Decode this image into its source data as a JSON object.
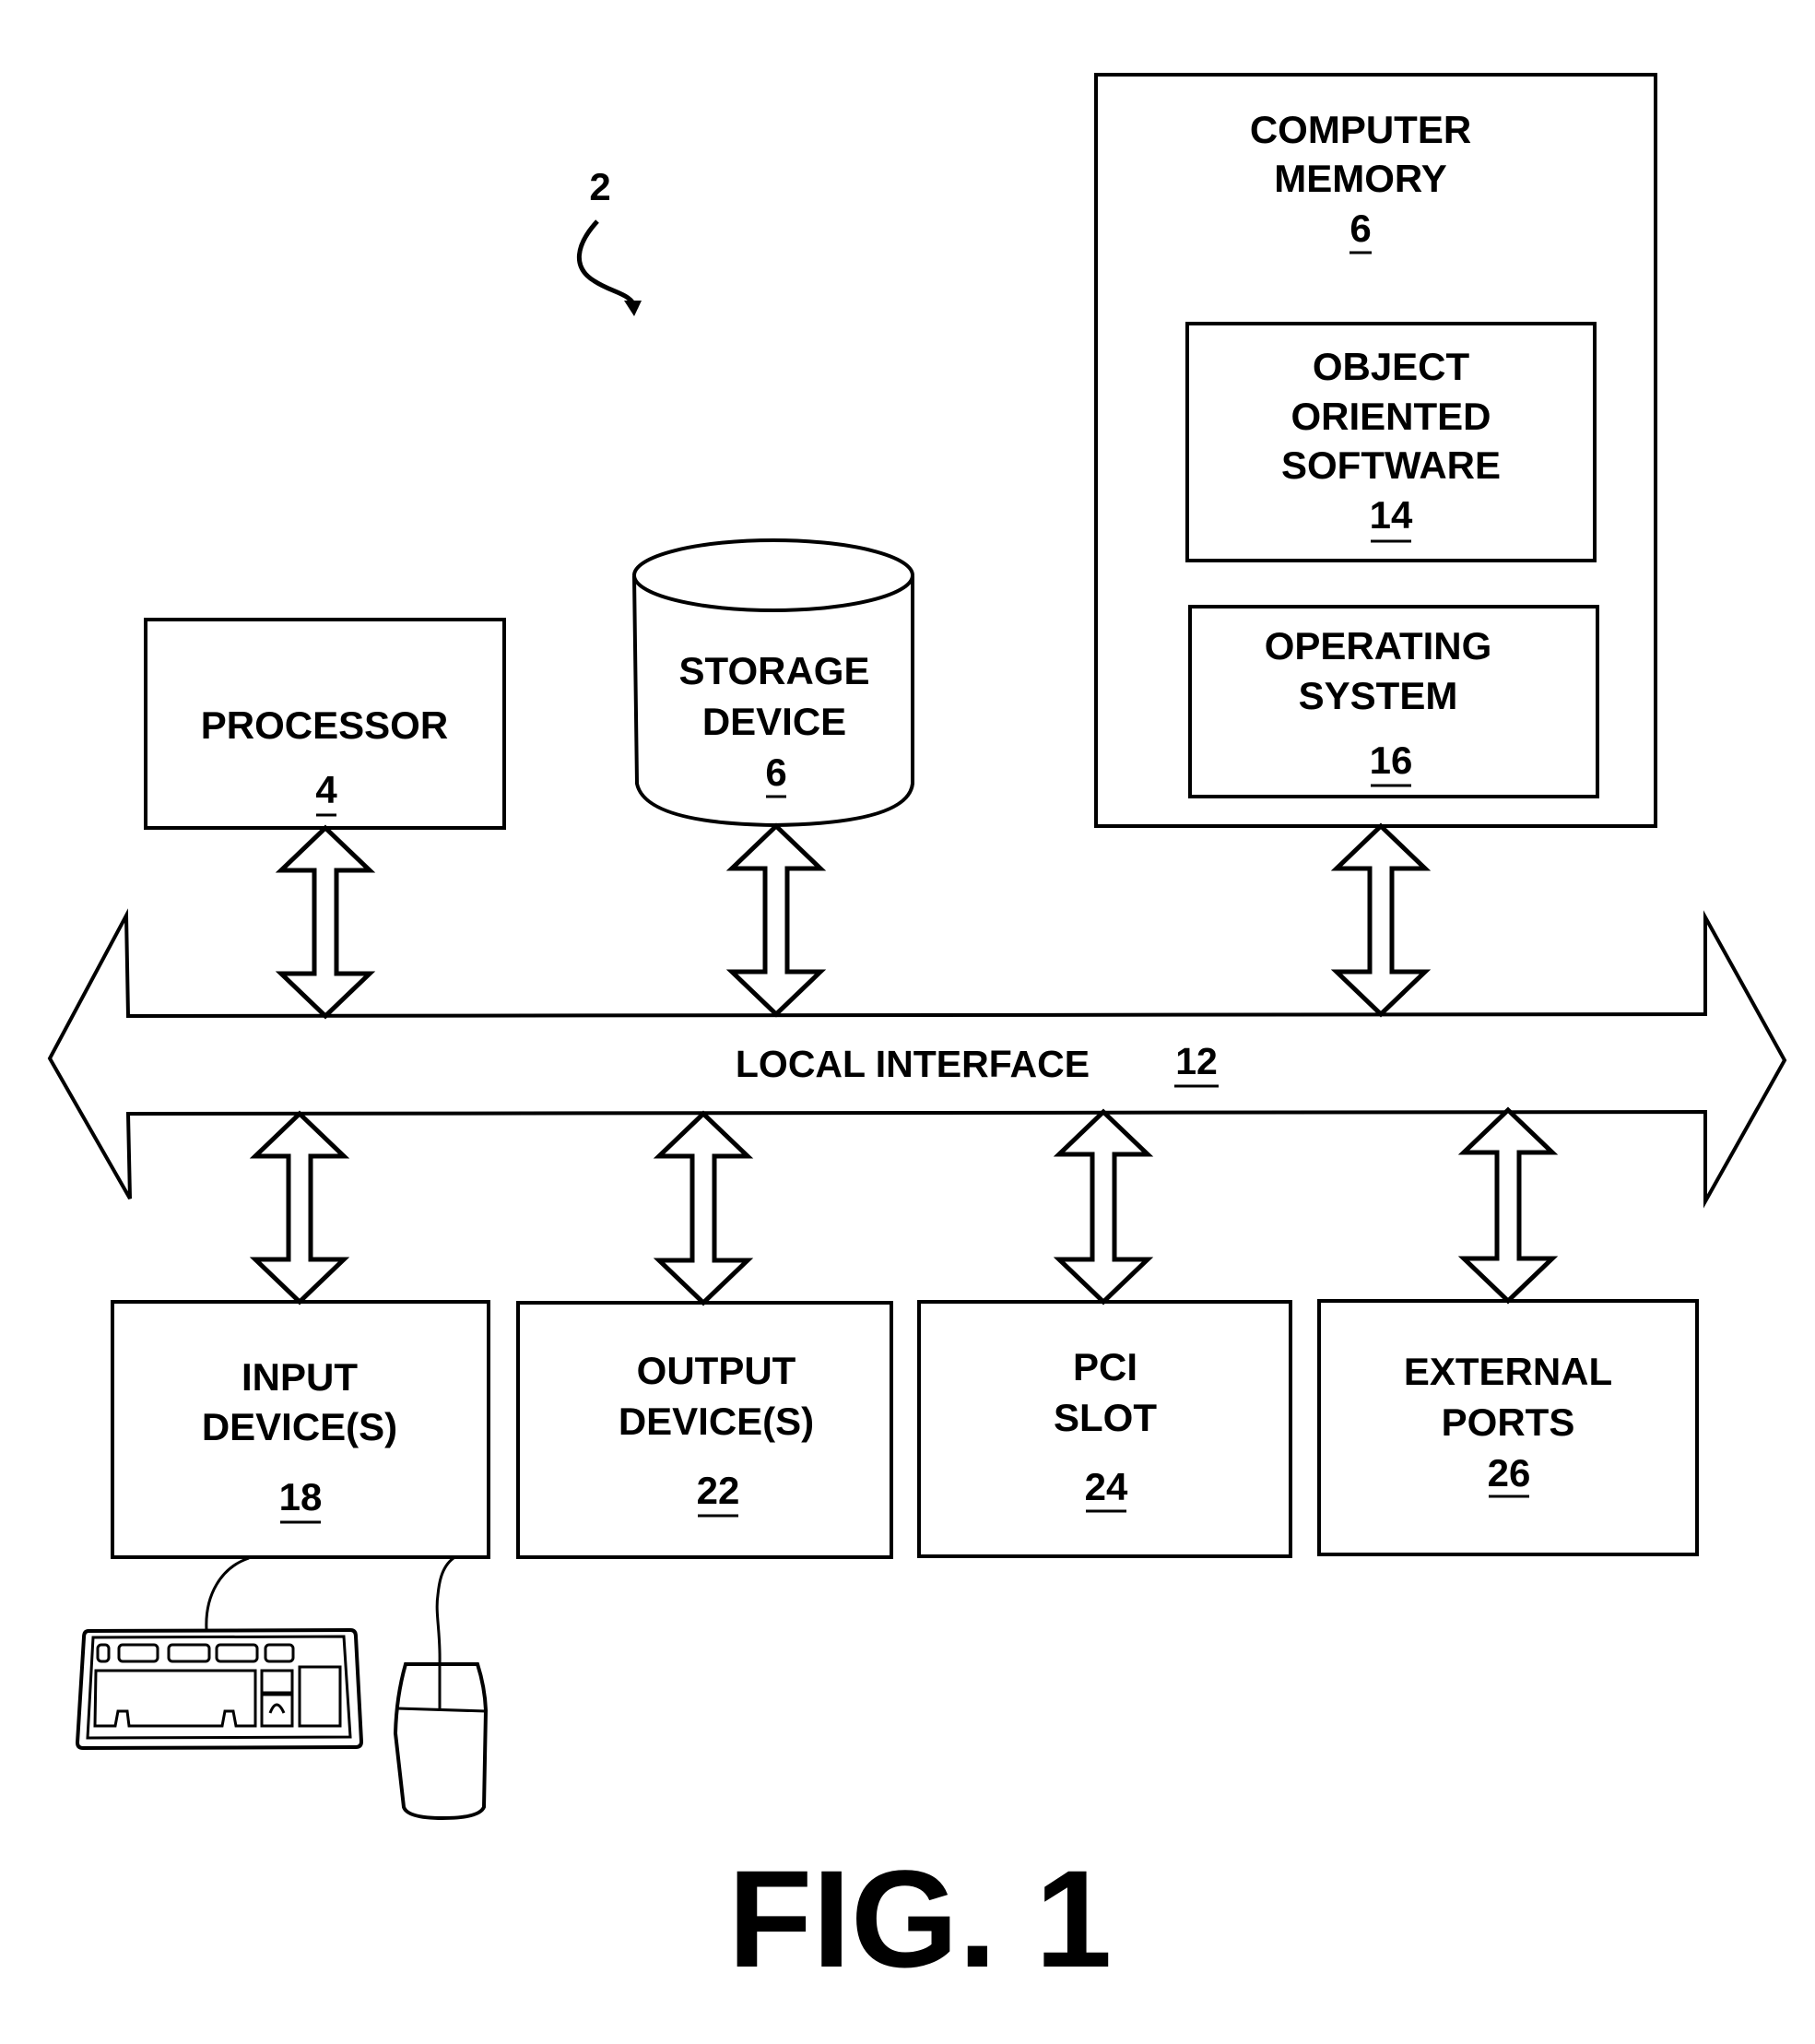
{
  "figure": {
    "caption": "FIG. 1",
    "reference_number": "2"
  },
  "components": {
    "computer_memory": {
      "lines": [
        "COMPUTER",
        "MEMORY"
      ],
      "ref": "6"
    },
    "object_oriented_software": {
      "lines": [
        "OBJECT",
        "ORIENTED",
        "SOFTWARE"
      ],
      "ref": "14"
    },
    "operating_system": {
      "lines": [
        "OPERATING",
        "SYSTEM"
      ],
      "ref": "16"
    },
    "processor": {
      "lines": [
        "PROCESSOR"
      ],
      "ref": "4"
    },
    "storage_device": {
      "lines": [
        "STORAGE",
        "DEVICE"
      ],
      "ref": "6"
    },
    "local_interface": {
      "label": "LOCAL INTERFACE",
      "ref": "12"
    },
    "input_devices": {
      "lines": [
        "INPUT",
        "DEVICE(S)"
      ],
      "ref": "18"
    },
    "output_devices": {
      "lines": [
        "OUTPUT",
        "DEVICE(S)"
      ],
      "ref": "22"
    },
    "pci_slot": {
      "lines": [
        "PCI",
        "SLOT"
      ],
      "ref": "24"
    },
    "external_ports": {
      "lines": [
        "EXTERNAL",
        "PORTS"
      ],
      "ref": "26"
    }
  },
  "peripherals": {
    "keyboard_icon": "keyboard-icon",
    "mouse_icon": "mouse-icon"
  }
}
